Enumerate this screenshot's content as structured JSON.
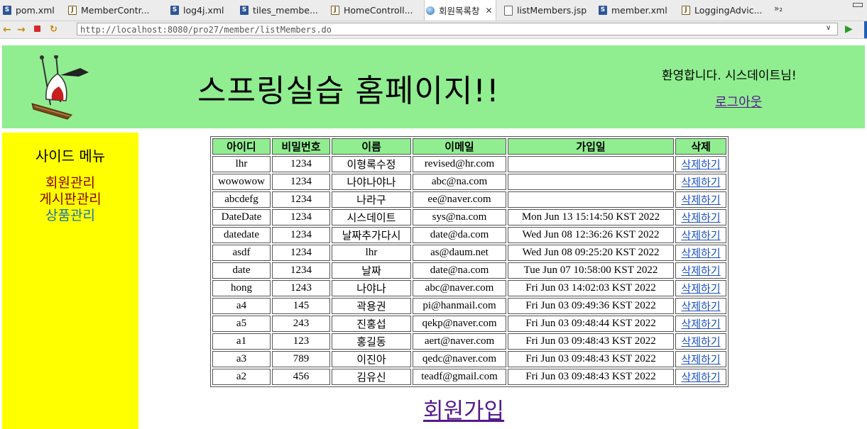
{
  "tabs": [
    {
      "icon": "xml-file-icon",
      "label": "pom.xml",
      "active": false
    },
    {
      "icon": "java-file-icon",
      "label": "MemberContr...",
      "active": false
    },
    {
      "icon": "xml-file-icon",
      "label": "log4j.xml",
      "active": false
    },
    {
      "icon": "xml-file-icon",
      "label": "tiles_membe...",
      "active": false
    },
    {
      "icon": "java-file-icon",
      "label": "HomeControll...",
      "active": false
    },
    {
      "icon": "globe-icon",
      "label": "회원목록창",
      "active": true
    },
    {
      "icon": "jsp-file-icon",
      "label": "listMembers.jsp",
      "active": false
    },
    {
      "icon": "xml-file-icon",
      "label": "member.xml",
      "active": false
    },
    {
      "icon": "java-file-icon",
      "label": "LoggingAdvic...",
      "active": false
    }
  ],
  "tab_overflow": "»₂",
  "browser": {
    "url": "http://localhost:8080/pro27/member/listMembers.do"
  },
  "header": {
    "title": "스프링실습 홈페이지!!",
    "welcome": "환영합니다. 시스데이트님!",
    "logout": "로그아웃"
  },
  "sidebar": {
    "title": "사이드 메뉴",
    "items": [
      {
        "label": "회원관리",
        "color": "#8b0000"
      },
      {
        "label": "게시판관리",
        "color": "#8b0000"
      },
      {
        "label": "상품관리",
        "color": "#1c6fa8"
      }
    ]
  },
  "members_table": {
    "headers": [
      "아이디",
      "비밀번호",
      "이름",
      "이메일",
      "가입일",
      "삭제"
    ],
    "delete_label": "삭제하기",
    "rows": [
      [
        "lhr",
        "1234",
        "이형록수정",
        "revised@hr.com",
        ""
      ],
      [
        "wowowow",
        "1234",
        "나야나야나",
        "abc@na.com",
        ""
      ],
      [
        "abcdefg",
        "1234",
        "나라구",
        "ee@naver.com",
        ""
      ],
      [
        "DateDate",
        "1234",
        "시스데이트",
        "sys@na.com",
        "Mon Jun 13 15:14:50 KST 2022"
      ],
      [
        "datedate",
        "1234",
        "날짜추가다시",
        "date@da.com",
        "Wed Jun 08 12:36:26 KST 2022"
      ],
      [
        "asdf",
        "1234",
        "lhr",
        "as@daum.net",
        "Wed Jun 08 09:25:20 KST 2022"
      ],
      [
        "date",
        "1234",
        "날짜",
        "date@na.com",
        "Tue Jun 07 10:58:00 KST 2022"
      ],
      [
        "hong",
        "1243",
        "나야나",
        "abc@naver.com",
        "Fri Jun 03 14:02:03 KST 2022"
      ],
      [
        "a4",
        "145",
        "곽용권",
        "pi@hanmail.com",
        "Fri Jun 03 09:49:36 KST 2022"
      ],
      [
        "a5",
        "243",
        "진홍섭",
        "qekp@naver.com",
        "Fri Jun 03 09:48:44 KST 2022"
      ],
      [
        "a1",
        "123",
        "홍길동",
        "aert@naver.com",
        "Fri Jun 03 09:48:43 KST 2022"
      ],
      [
        "a3",
        "789",
        "이진아",
        "qedc@naver.com",
        "Fri Jun 03 09:48:43 KST 2022"
      ],
      [
        "a2",
        "456",
        "김유신",
        "teadf@gmail.com",
        "Fri Jun 03 09:48:43 KST 2022"
      ]
    ]
  },
  "signup_link": "회원가입"
}
